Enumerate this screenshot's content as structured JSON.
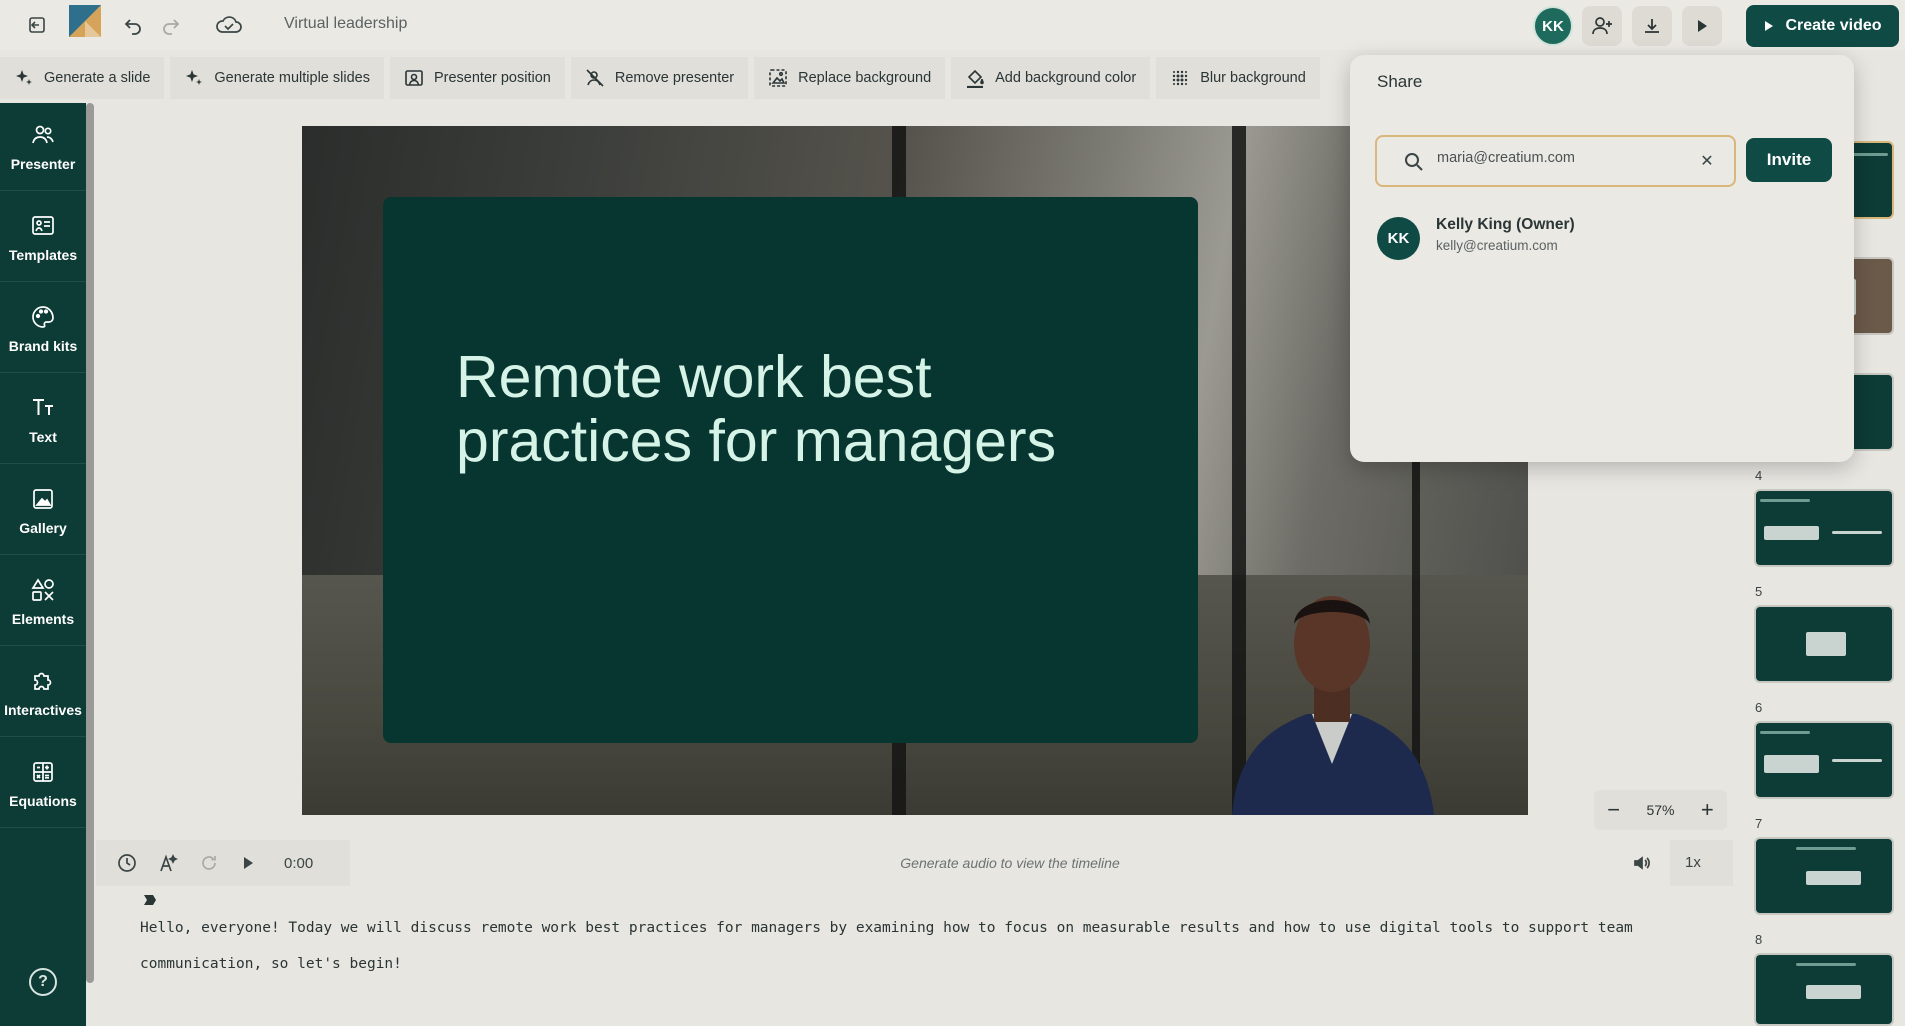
{
  "header": {
    "doc_title": "Virtual leadership",
    "avatar_initials": "KK",
    "create_label": "Create video"
  },
  "toolbar": {
    "items": [
      {
        "label": "Generate a slide",
        "icon": "sparkle-icon"
      },
      {
        "label": "Generate multiple slides",
        "icon": "sparkle-icon"
      },
      {
        "label": "Presenter position",
        "icon": "presenter-position-icon"
      },
      {
        "label": "Remove presenter",
        "icon": "remove-presenter-icon"
      },
      {
        "label": "Replace background",
        "icon": "replace-background-icon"
      },
      {
        "label": "Add background color",
        "icon": "paint-bucket-icon"
      },
      {
        "label": "Blur background",
        "icon": "blur-icon"
      }
    ]
  },
  "sidebar": {
    "items": [
      {
        "label": "Presenter",
        "icon": "presenter-icon"
      },
      {
        "label": "Templates",
        "icon": "templates-icon"
      },
      {
        "label": "Brand kits",
        "icon": "palette-icon"
      },
      {
        "label": "Text",
        "icon": "text-icon"
      },
      {
        "label": "Gallery",
        "icon": "gallery-icon"
      },
      {
        "label": "Elements",
        "icon": "elements-icon"
      },
      {
        "label": "Interactives",
        "icon": "puzzle-icon"
      },
      {
        "label": "Equations",
        "icon": "calculator-icon"
      }
    ],
    "help": "?"
  },
  "slide": {
    "title": "Remote work best practices for managers"
  },
  "zoom": {
    "minus": "−",
    "value": "57%",
    "plus": "+"
  },
  "timeline": {
    "time": "0:00",
    "placeholder": "Generate audio to view the timeline",
    "speed": "1x"
  },
  "script": {
    "text": "Hello, everyone! Today we will discuss remote work best practices for managers by examining how to focus on measurable results and how to use digital tools to support team communication, so let's begin!"
  },
  "thumbnails": {
    "numbers": [
      "4",
      "5",
      "6",
      "7",
      "8"
    ]
  },
  "share": {
    "title": "Share",
    "input_value": "maria@creatium.com",
    "invite_label": "Invite",
    "member": {
      "initials": "KK",
      "name": "Kelly King (Owner)",
      "email": "kelly@creatium.com"
    }
  },
  "colors": {
    "brand_dark": "#0d3b35",
    "button": "#0f4a44",
    "input_border": "#d9b67a",
    "slide_text": "#d6f3e8"
  }
}
